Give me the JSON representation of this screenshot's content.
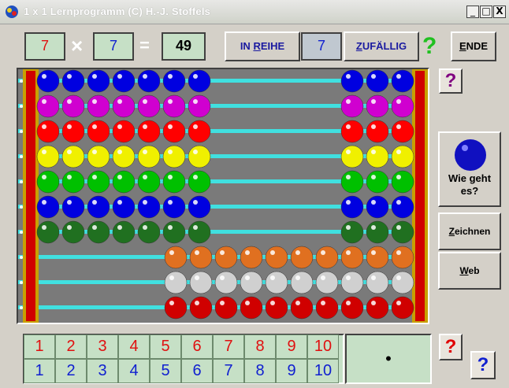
{
  "window": {
    "title": "1 x 1 Lernprogramm (C) H.-J. Stoffels",
    "min": "_",
    "max": "□",
    "close": "X"
  },
  "equation": {
    "a": "7",
    "op": "×",
    "b": "7",
    "eq": "=",
    "result": "49"
  },
  "toolbar": {
    "in_reihe": "IN REIHE",
    "in_reihe_hot": "R",
    "mode_value": "7",
    "zufaellig": "ZUFÄLLIG",
    "zufaellig_hot": "Z",
    "check_mark": "?",
    "ende": "ENDE",
    "ende_hot": "E"
  },
  "side": {
    "help_top": "?",
    "wie_geht_es": "Wie geht es?",
    "zeichnen": "Zeichnen",
    "zeichnen_hot": "Z",
    "web": "Web",
    "web_hot": "W"
  },
  "bottom": {
    "red_row": [
      "1",
      "2",
      "3",
      "4",
      "5",
      "6",
      "7",
      "8",
      "9",
      "10"
    ],
    "blue_row": [
      "1",
      "2",
      "3",
      "4",
      "5",
      "6",
      "7",
      "8",
      "9",
      "10"
    ],
    "display_value": "•",
    "help_red": "?",
    "help_blue": "?"
  },
  "abacus": {
    "rows_left_counts": [
      7,
      7,
      7,
      7,
      7,
      7,
      7,
      0,
      0,
      0
    ],
    "rows_right_counts": [
      3,
      3,
      3,
      3,
      3,
      3,
      3,
      10,
      10,
      10
    ],
    "row_colors": [
      "#0000e0",
      "#d000d0",
      "#ff0000",
      "#f0f000",
      "#00c000",
      "#0000e0",
      "#207020",
      "#e07020",
      "#d0d0d0",
      "#d00000"
    ]
  },
  "colors": {
    "rod": "#40e0e0",
    "frame_red": "#d00000",
    "frame_gold": "#c8a000",
    "check_green": "#20c020",
    "help_purple": "#800080",
    "help_red": "#e00000",
    "help_blue": "#1020d0"
  }
}
